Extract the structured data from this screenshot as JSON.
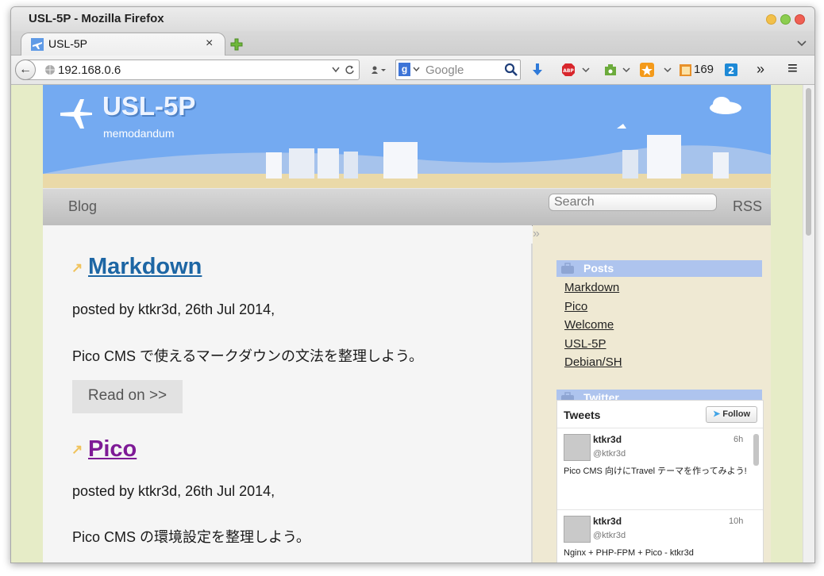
{
  "window": {
    "title": "USL-5P - Mozilla Firefox"
  },
  "tabs": [
    {
      "label": "USL-5P",
      "close": "×"
    }
  ],
  "toolbar": {
    "url": "192.168.0.6",
    "search_placeholder": "Google",
    "badge_count": "169",
    "overflow": "»",
    "menu": "≡"
  },
  "site": {
    "title": "USL-5P",
    "subtitle": "memodandum"
  },
  "menu": {
    "blog": "Blog",
    "search_placeholder": "Search",
    "rss": "RSS"
  },
  "posts": [
    {
      "title": "Markdown",
      "meta": "posted by ktkr3d, 26th Jul 2014,",
      "excerpt": "Pico CMS で使えるマークダウンの文法を整理しよう。",
      "read_on": "Read on >>"
    },
    {
      "title": "Pico",
      "meta": "posted by ktkr3d, 26th Jul 2014,",
      "excerpt": "Pico CMS の環境設定を整理しよう。"
    }
  ],
  "sidebar": {
    "collapse": "»",
    "posts_heading": "Posts",
    "post_links": [
      "Markdown",
      "Pico",
      "Welcome",
      "USL-5P",
      "Debian/SH"
    ],
    "twitter_heading": "Twitter",
    "tweets_label": "Tweets",
    "follow": "Follow",
    "tweets": [
      {
        "name": "ktkr3d",
        "handle": "@ktkr3d",
        "time": "6h",
        "text": "Pico CMS 向けにTravel テーマを作ってみよう!"
      },
      {
        "name": "ktkr3d",
        "handle": "@ktkr3d",
        "time": "10h",
        "text": "Nginx + PHP-FPM + Pico - ktkr3d"
      }
    ]
  },
  "colors": {
    "header_sky": "#74aaf1",
    "link_blue": "#1d66a4",
    "link_visited": "#7e1a96",
    "sidebar_bg": "#efe9d3",
    "widget_head": "#aec4ee",
    "page_bg": "#e6ecc7"
  }
}
